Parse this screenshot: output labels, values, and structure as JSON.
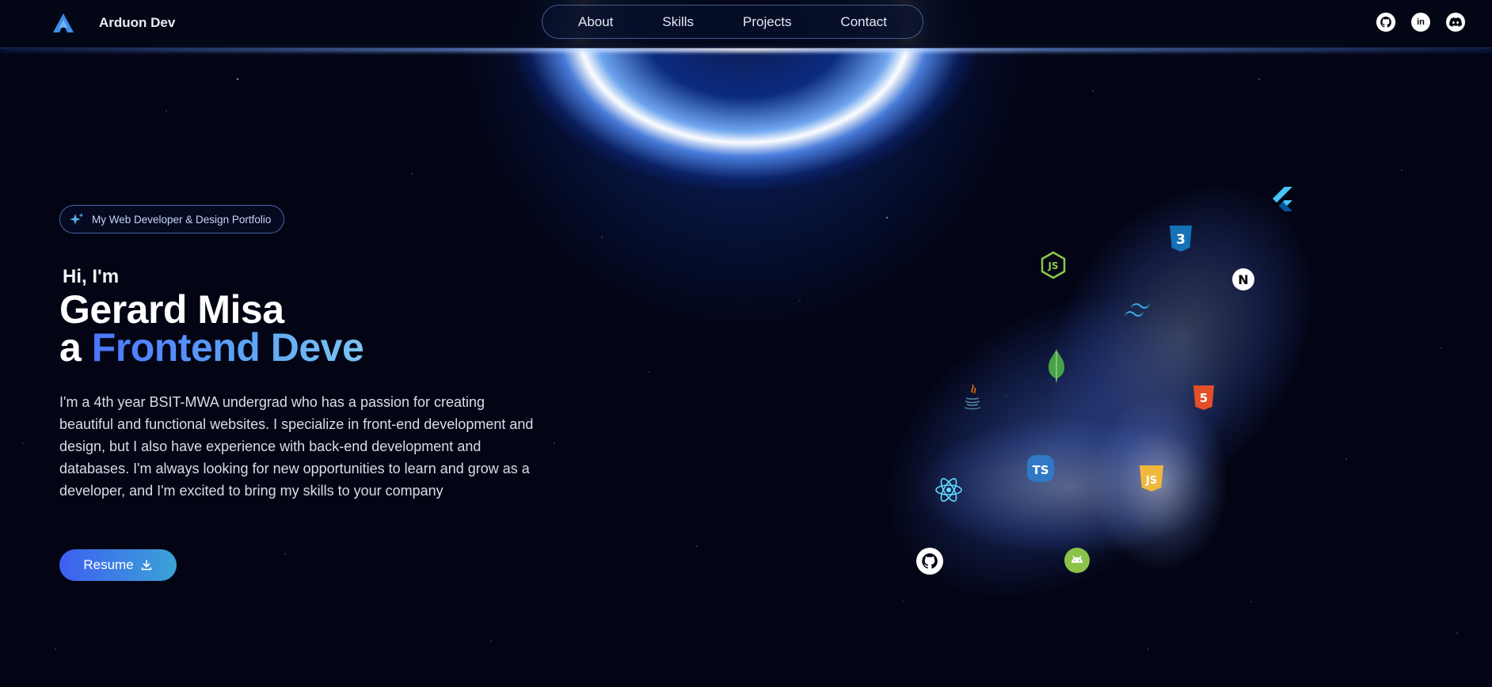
{
  "header": {
    "brand": "Arduon Dev",
    "nav": [
      "About",
      "Skills",
      "Projects",
      "Contact"
    ],
    "socials": [
      "github-icon",
      "linkedin-icon",
      "discord-icon"
    ]
  },
  "hero": {
    "badge": "My Web Developer & Design Portfolio",
    "greeting": "Hi, I'm",
    "name": "Gerard Misa",
    "role_prefix": "a",
    "role_highlight": "Frontend Deve",
    "description": "I'm a 4th year BSIT-MWA undergrad who has a passion for creating beautiful and functional websites. I specialize in front-end development and design, but I also have experience with back-end development and databases. I'm always looking for new opportunities to learn and grow as a developer, and I'm excited to bring my skills to your company",
    "resume_label": "Resume"
  },
  "tech_icons": [
    "flutter-icon",
    "css3-icon",
    "nodejs-icon",
    "nextjs-icon",
    "tailwind-icon",
    "mongodb-icon",
    "java-icon",
    "html5-icon",
    "typescript-icon",
    "javascript-icon",
    "react-icon",
    "github-icon",
    "android-icon"
  ],
  "tech_labels": {
    "typescript": "TS",
    "javascript": "JS",
    "nodejs": "JS",
    "css3": "3",
    "html5": "5",
    "nextjs": "N"
  },
  "colors": {
    "background": "#030515",
    "accent_start": "#3e5ff0",
    "accent_end": "#3aa3d6",
    "highlight_text": "#5ea7f5"
  }
}
